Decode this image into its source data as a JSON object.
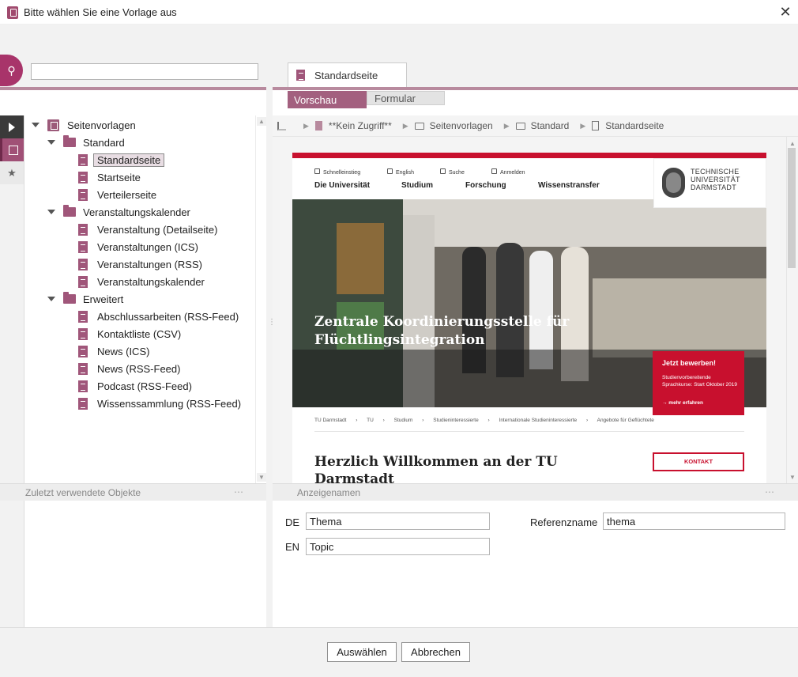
{
  "window": {
    "title": "Bitte wählen Sie eine Vorlage aus",
    "close_glyph": "✕"
  },
  "search": {
    "value": "",
    "placeholder": ""
  },
  "rail": {
    "items": [
      "play-icon",
      "tree-icon",
      "star-icon"
    ]
  },
  "tree": {
    "root": "Seitenvorlagen",
    "groups": [
      {
        "label": "Standard",
        "items": [
          "Standardseite",
          "Startseite",
          "Verteilerseite"
        ]
      },
      {
        "label": "Veranstaltungskalender",
        "items": [
          "Veranstaltung (Detailseite)",
          "Veranstaltungen (ICS)",
          "Veranstaltungen (RSS)",
          "Veranstaltungskalender"
        ]
      },
      {
        "label": "Erweitert",
        "items": [
          "Abschlussarbeiten (RSS-Feed)",
          "Kontaktliste (CSV)",
          "News (ICS)",
          "News (RSS-Feed)",
          "Podcast (RSS-Feed)",
          "Wissenssammlung (RSS-Feed)"
        ]
      }
    ],
    "selected": "Standardseite"
  },
  "editor": {
    "doc_tab": "Standardseite",
    "view_tabs": {
      "preview": "Vorschau",
      "form": "Formular"
    },
    "breadcrumb": [
      "**Kein Zugriff**",
      "Seitenvorlagen",
      "Standard",
      "Standardseite"
    ]
  },
  "site": {
    "util_links": [
      "Schnelleinstieg",
      "English",
      "Suche",
      "Anmelden"
    ],
    "nav": [
      "Die Universität",
      "Studium",
      "Forschung",
      "Wissenstransfer"
    ],
    "logo_text": [
      "TECHNISCHE",
      "UNIVERSITÄT",
      "DARMSTADT"
    ],
    "hero_title_1": "Zentrale Koordinierungsstelle für",
    "hero_title_2": "Flüchtlingsintegration",
    "cta_title": "Jetzt bewerben!",
    "cta_text": "Studienvorbereitende Sprachkurse: Start Oktober 2019",
    "cta_link": "→ mehr erfahren",
    "crumbs": [
      "TU Darmstadt",
      "›",
      "TU",
      "›",
      "Studium",
      "›",
      "Studieninteressierte",
      "›",
      "Internationale Studieninteressierte",
      "›",
      "Angebote für Geflüchtete"
    ],
    "welcome": "Herzlich Willkommen an der TU Darmstadt",
    "contact_btn": "KONTAKT"
  },
  "recent": {
    "title": "Zuletzt verwendete Objekte"
  },
  "names": {
    "title": "Anzeigenamen",
    "de_label": "DE",
    "de_value": "Thema",
    "en_label": "EN",
    "en_value": "Topic",
    "ref_label": "Referenzname",
    "ref_value": "thema"
  },
  "buttons": {
    "select": "Auswählen",
    "cancel": "Abbrechen"
  },
  "colors": {
    "accent": "#a3607f",
    "search": "#a8346a",
    "tu_red": "#c8102e"
  }
}
